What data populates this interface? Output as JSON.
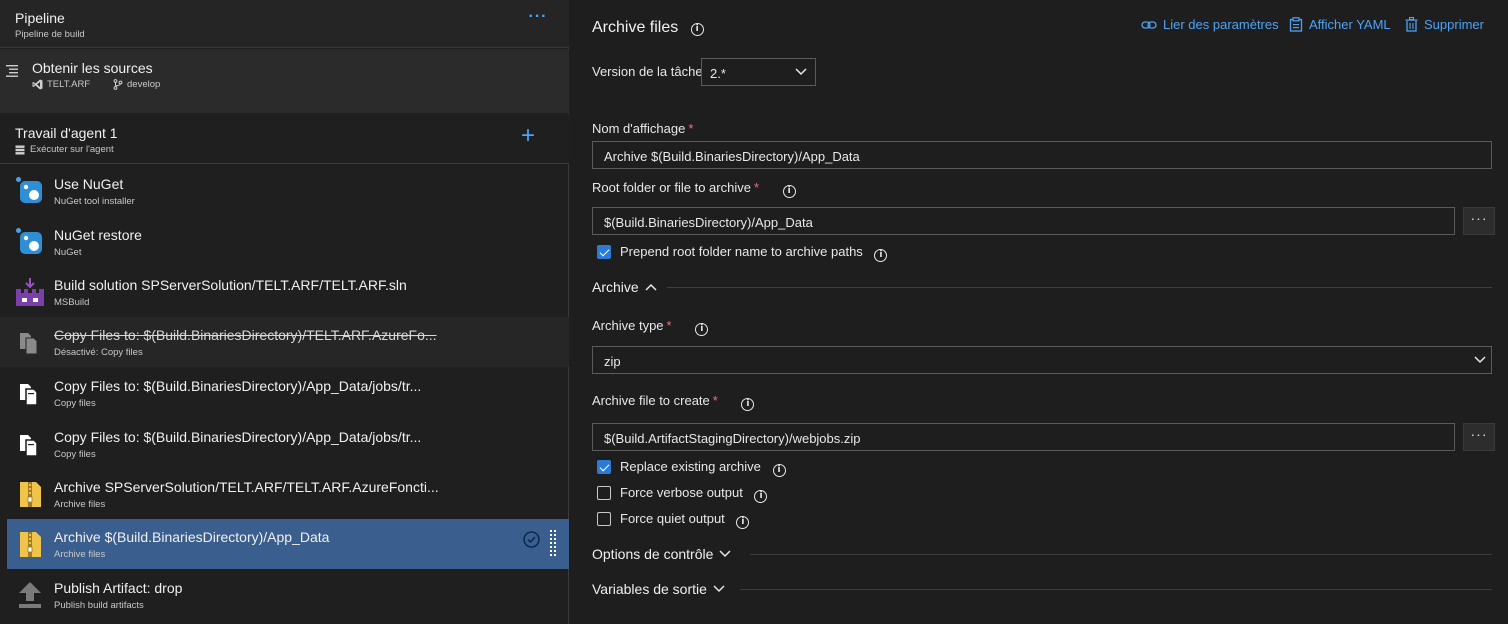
{
  "pipeline": {
    "title": "Pipeline",
    "subtitle": "Pipeline de build",
    "more": "···"
  },
  "sources": {
    "title": "Obtenir les sources",
    "repo": "TELT.ARF",
    "branch": "develop"
  },
  "job": {
    "title": "Travail d'agent 1",
    "subtitle": "Exécuter sur l'agent",
    "add": "+"
  },
  "tasks": [
    {
      "name": "Use NuGet",
      "sub": "NuGet tool installer",
      "icon": "nuget-icon"
    },
    {
      "name": "NuGet restore",
      "sub": "NuGet",
      "icon": "nuget-icon"
    },
    {
      "name": "Build solution SPServerSolution/TELT.ARF/TELT.ARF.sln",
      "sub": "MSBuild",
      "icon": "msbuild-icon"
    },
    {
      "name": "Copy Files to: $(Build.BinariesDirectory)/TELT.ARF.AzureFo...",
      "sub": "Désactivé: Copy files",
      "icon": "copy-files-icon",
      "disabled": true
    },
    {
      "name": "Copy Files to: $(Build.BinariesDirectory)/App_Data/jobs/tr...",
      "sub": "Copy files",
      "icon": "copy-files-icon"
    },
    {
      "name": "Copy Files to: $(Build.BinariesDirectory)/App_Data/jobs/tr...",
      "sub": "Copy files",
      "icon": "copy-files-icon"
    },
    {
      "name": "Archive SPServerSolution/TELT.ARF/TELT.ARF.AzureFoncti...",
      "sub": "Archive files",
      "icon": "archive-icon"
    },
    {
      "name": "Archive $(Build.BinariesDirectory)/App_Data",
      "sub": "Archive files",
      "icon": "archive-icon",
      "selected": true
    },
    {
      "name": "Publish Artifact: drop",
      "sub": "Publish build artifacts",
      "icon": "publish-icon"
    }
  ],
  "detail": {
    "title": "Archive files",
    "actions": {
      "link": "Lier des paramètres",
      "yaml": "Afficher YAML",
      "delete": "Supprimer"
    },
    "version_label": "Version de la tâche",
    "version_value": "2.*",
    "display_name_label": "Nom d'affichage",
    "display_name_value": "Archive $(Build.BinariesDirectory)/App_Data",
    "root_label": "Root folder or file to archive",
    "root_value": "$(Build.BinariesDirectory)/App_Data",
    "prepend_label": "Prepend root folder name to archive paths",
    "archive_section": "Archive",
    "archive_type_label": "Archive type",
    "archive_type_value": "zip",
    "archive_file_label": "Archive file to create",
    "archive_file_value": "$(Build.ArtifactStagingDirectory)/webjobs.zip",
    "replace_label": "Replace existing archive",
    "verbose_label": "Force verbose output",
    "quiet_label": "Force quiet output",
    "control_section": "Options de contrôle",
    "output_section": "Variables de sortie",
    "required_mark": "*",
    "dots": "···"
  },
  "colors": {
    "accent": "#4ea3f5",
    "selected_bg": "#3a5f8e",
    "required": "#f1707b",
    "checkbox": "#2b7bd6"
  }
}
